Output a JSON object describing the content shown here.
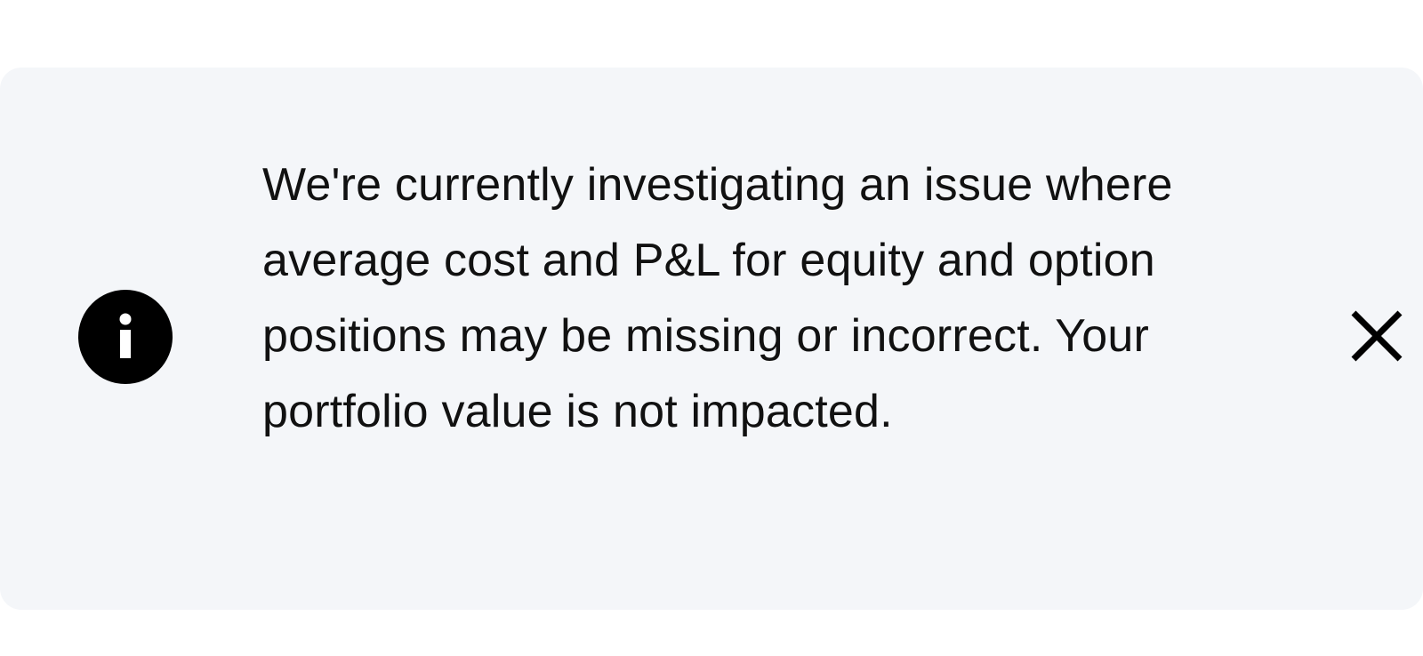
{
  "banner": {
    "icon": "info-icon",
    "message": "We're currently investigating an issue where average cost and P&L for equity and option positions may be missing or incorrect. Your portfolio value is not impacted.",
    "close_icon": "close-icon",
    "background_color": "#f4f6f9",
    "icon_color": "#000000",
    "text_color": "#111111"
  }
}
